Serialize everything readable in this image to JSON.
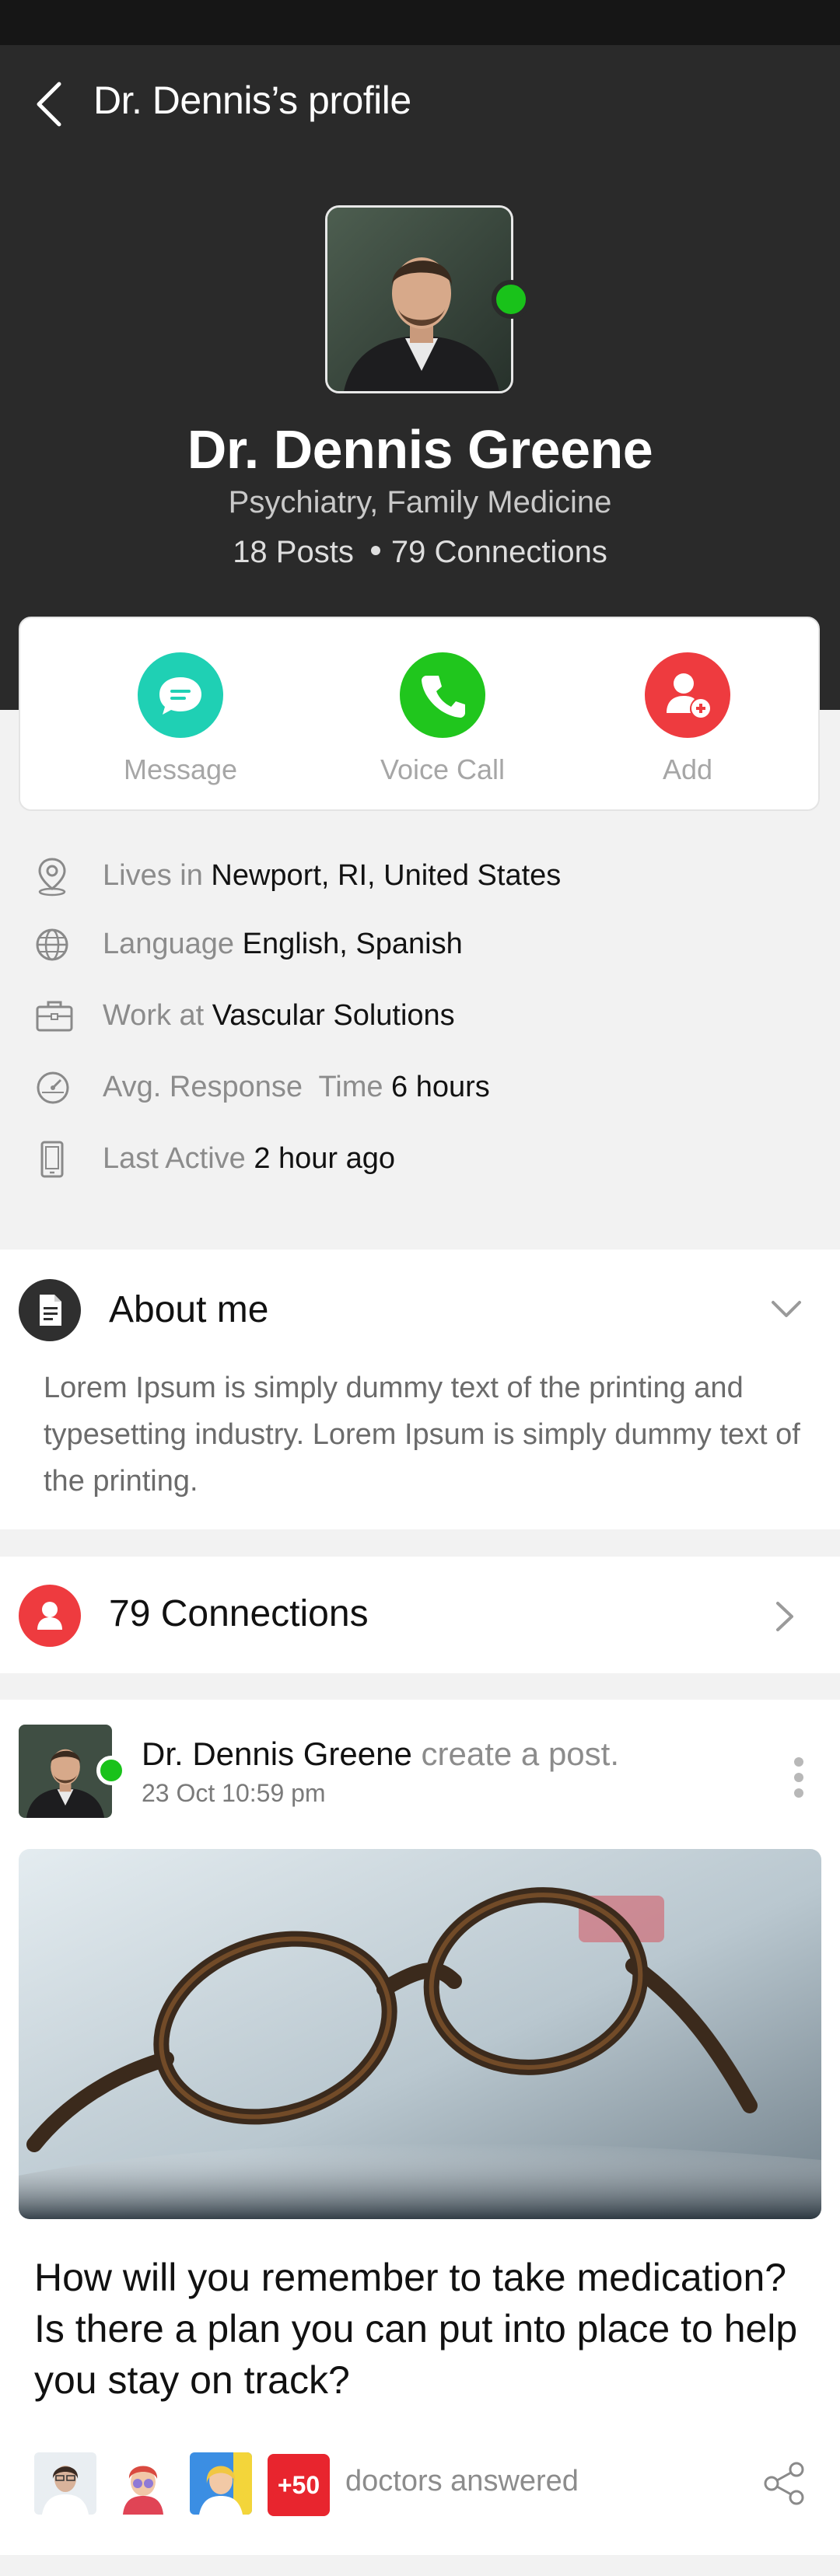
{
  "nav": {
    "title": "Dr. Dennis’s profile"
  },
  "profile": {
    "name": "Dr. Dennis Greene",
    "specialties": "Psychiatry, Family Medicine",
    "posts": "18 Posts",
    "connections": "79 Connections",
    "status": "online"
  },
  "actions": [
    {
      "label": "Message",
      "icon": "chat-bubble-icon",
      "color": "#1fd0b4"
    },
    {
      "label": "Voice Call",
      "icon": "phone-icon",
      "color": "#20c61d"
    },
    {
      "label": "Add",
      "icon": "add-user-icon",
      "color": "#ee3b3f"
    }
  ],
  "info": {
    "lives_key": "Lives in",
    "lives_val": "Newport, RI, United States",
    "lang_key": "Language",
    "lang_val": "English, Spanish",
    "work_key": "Work at",
    "work_val": "Vascular Solutions",
    "resp_key": "Avg. Response  Time",
    "resp_val": "6 hours",
    "active_key": "Last Active",
    "active_val": "2 hour ago"
  },
  "about": {
    "title": "About me",
    "text": "Lorem Ipsum is simply dummy text of the printing and typesetting industry. Lorem Ipsum is simply dummy text of the printing."
  },
  "connections_section": {
    "title": "79 Connections"
  },
  "post": {
    "author": "Dr. Dennis Greene",
    "action": "create a post.",
    "time": "23 Oct 10:59 pm",
    "question": "How will you remember to take medication? Is there a plan you can put into place to help you stay on track?",
    "more_count": "+50",
    "answered_text": "doctors answered"
  },
  "colors": {
    "header_bg": "#2a2a2a",
    "online": "#19c21a",
    "accent_red": "#ee3b3f"
  }
}
